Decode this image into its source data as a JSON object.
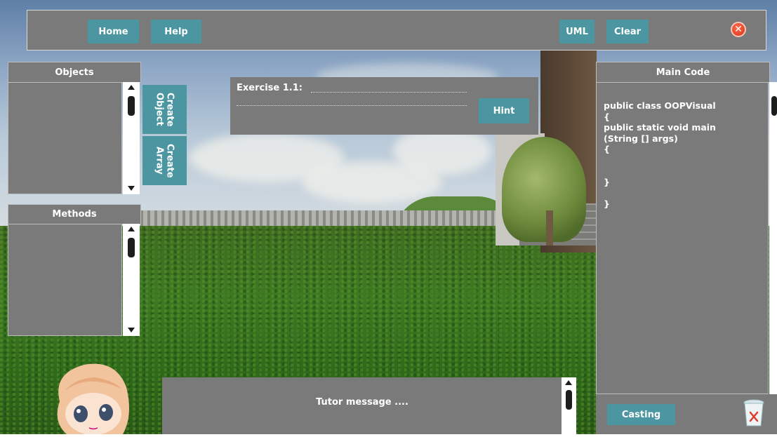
{
  "toolbar": {
    "home_label": "Home",
    "help_label": "Help",
    "uml_label": "UML",
    "clear_label": "Clear",
    "close_icon": "close-icon"
  },
  "objects_panel": {
    "title": "Objects",
    "create_object_label": "Create\nObject",
    "create_array_label": "Create\nArray"
  },
  "methods_panel": {
    "title": "Methods"
  },
  "exercise": {
    "title": "Exercise 1.1:",
    "hint_label": "Hint"
  },
  "main_code": {
    "title": "Main Code",
    "code": "public class OOPVisual\n{\npublic static void main\n(String [] args)\n{\n\n\n}\n\n}",
    "casting_label": "Casting",
    "trash_icon": "trash-icon"
  },
  "tutor": {
    "message": "Tutor message ...."
  },
  "colors": {
    "panel": "#7a7a7a",
    "button": "#4b96a0"
  }
}
